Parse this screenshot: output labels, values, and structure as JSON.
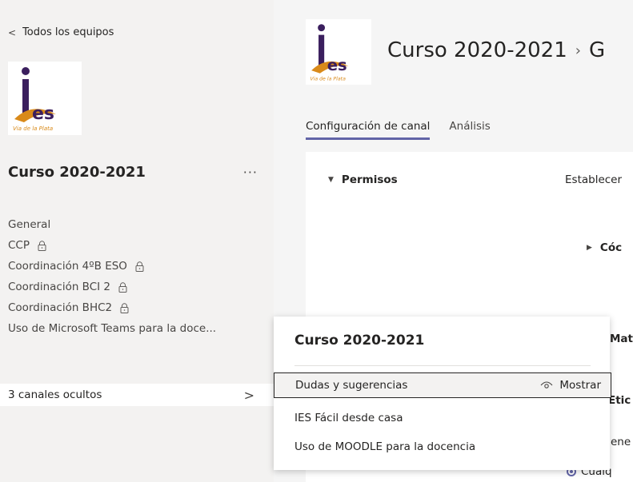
{
  "sidebar": {
    "back_label": "Todos los equipos",
    "team_name": "Curso 2020-2021",
    "more_label": "···",
    "logo": {
      "letters": "es",
      "caption": "Via de la Plata",
      "accent": "#3b1f5e",
      "leaf": "#d98a1a"
    },
    "channels": [
      {
        "label": "General",
        "locked": false
      },
      {
        "label": "CCP",
        "locked": true
      },
      {
        "label": "Coordinación 4ºB ESO",
        "locked": true
      },
      {
        "label": "Coordinación BCI 2",
        "locked": true
      },
      {
        "label": "Coordinación BHC2",
        "locked": true
      },
      {
        "label": "Uso de Microsoft Teams para la doce...",
        "locked": false
      }
    ],
    "hidden_channels_label": "3 canales ocultos"
  },
  "header": {
    "title": "Curso 2020-2021",
    "separator": "›",
    "crumb_next": "G"
  },
  "tabs": [
    {
      "label": "Configuración de canal",
      "active": true
    },
    {
      "label": "Análisis",
      "active": false
    }
  ],
  "settings": {
    "permissions_label": "Permisos",
    "permissions_desc": "Establecer",
    "code_label": "Cóc",
    "ma_label": "Mat",
    "eti_label": "Etic",
    "gen_label": "ene",
    "cual_label": "Cualq"
  },
  "popup": {
    "title": "Curso 2020-2021",
    "items": [
      {
        "label": "Dudas y sugerencias",
        "action": "Mostrar"
      },
      {
        "label": "IES Fácil desde casa"
      },
      {
        "label": "Uso de MOODLE para la docencia"
      }
    ]
  },
  "colors": {
    "accent": "#6264a7",
    "sidebar_bg": "#f3f2f1"
  }
}
